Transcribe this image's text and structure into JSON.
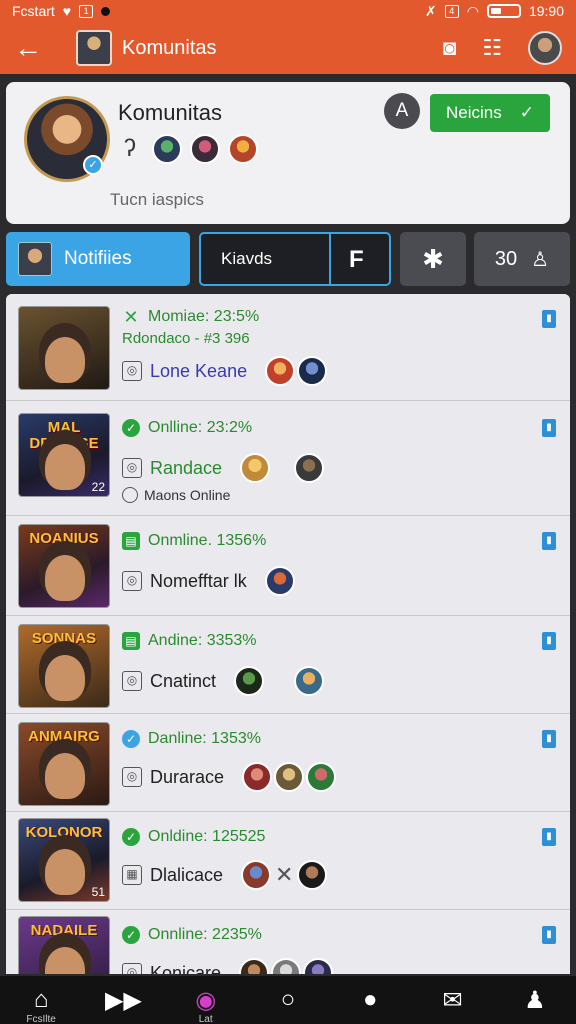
{
  "status_bar": {
    "left_text": "Fcstart",
    "time": "19:90"
  },
  "app_bar": {
    "title": "Komunitas"
  },
  "community_card": {
    "name": "Komunitas",
    "subtitle": "Tucn iaspics",
    "a_badge": "A",
    "join_label": "Neicins",
    "join_check": "✓"
  },
  "tabs": {
    "notifications": "Notifiies",
    "search_text": "Kiavds",
    "count": "30"
  },
  "feed": [
    {
      "thumb_title": "",
      "status": "Momiae: 23:5%",
      "status_icon": "x",
      "sub": "Rdondaco - #3 396",
      "name": "Lone Keane",
      "name_color": "blue",
      "extra": "",
      "thumb_num": ""
    },
    {
      "thumb_title": "MAL DREIILSE",
      "status": "Onlline: 23:2%",
      "status_icon": "check",
      "sub": "",
      "name": "Randace",
      "name_color": "green",
      "extra": "Maons Online",
      "thumb_num": "22"
    },
    {
      "thumb_title": "NOANIUS",
      "status": "Onmline. 1356%",
      "status_icon": "square",
      "sub": "",
      "name": "Nomefftar lk",
      "name_color": "dark",
      "extra": "",
      "thumb_num": ""
    },
    {
      "thumb_title": "SONNAS",
      "status": "Andine: 3353%",
      "status_icon": "square",
      "sub": "",
      "name": "Cnatinct",
      "name_color": "dark",
      "extra": "",
      "thumb_num": ""
    },
    {
      "thumb_title": "ANMAIRG",
      "status": "Danline: 1353%",
      "status_icon": "check-blue",
      "sub": "",
      "name": "Durarace",
      "name_color": "dark",
      "extra": "",
      "thumb_num": ""
    },
    {
      "thumb_title": "KOLONOR",
      "status": "Onldine: 125525",
      "status_icon": "check",
      "sub": "",
      "name": "Dlalicace",
      "name_color": "dark",
      "extra": "",
      "thumb_num": "51"
    },
    {
      "thumb_title": "NADAILE",
      "status": "Onnline: 2235%",
      "status_icon": "check",
      "sub": "",
      "name": "Konicare",
      "name_color": "dark",
      "extra": "",
      "thumb_num": ""
    }
  ],
  "colors": {
    "accent": "#e2592e",
    "tab_blue": "#3aa4e4",
    "online_green": "#2aa43d",
    "nav_active": "#d53ec9"
  },
  "bottom_nav": {
    "home_label": "FcsIlte",
    "active_label": "Lat"
  }
}
